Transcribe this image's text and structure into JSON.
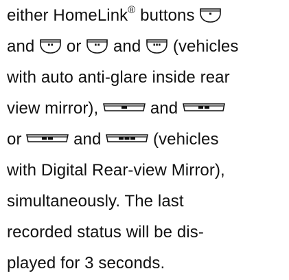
{
  "text": {
    "l1_a": "either HomeLink",
    "l1_reg": "®",
    "l1_b": " buttons ",
    "l2_a": "and ",
    "l2_b": " or ",
    "l2_c": " and ",
    "l2_d": " (vehicles",
    "l3": "with auto anti-glare inside rear",
    "l4_a": "view mirror), ",
    "l4_b": " and ",
    "l5_a": "or ",
    "l5_b": " and ",
    "l5_c": " (vehicles",
    "l6": "with Digital Rear-view Mirror),",
    "l7": "simultaneously. The last",
    "l8": "recorded status will be dis-",
    "l9": "played for 3 seconds."
  },
  "icons": {
    "homelink_button_1": "homelink-button-1-dot-icon",
    "homelink_button_2": "homelink-button-2-dots-icon",
    "homelink_button_3": "homelink-button-3-dots-icon",
    "mirror_button_1": "digital-mirror-button-1-bar-icon",
    "mirror_button_2": "digital-mirror-button-2-bars-icon",
    "mirror_button_3": "digital-mirror-button-3-bars-icon"
  },
  "colors": {
    "text": "#111111",
    "background": "#ffffff"
  }
}
